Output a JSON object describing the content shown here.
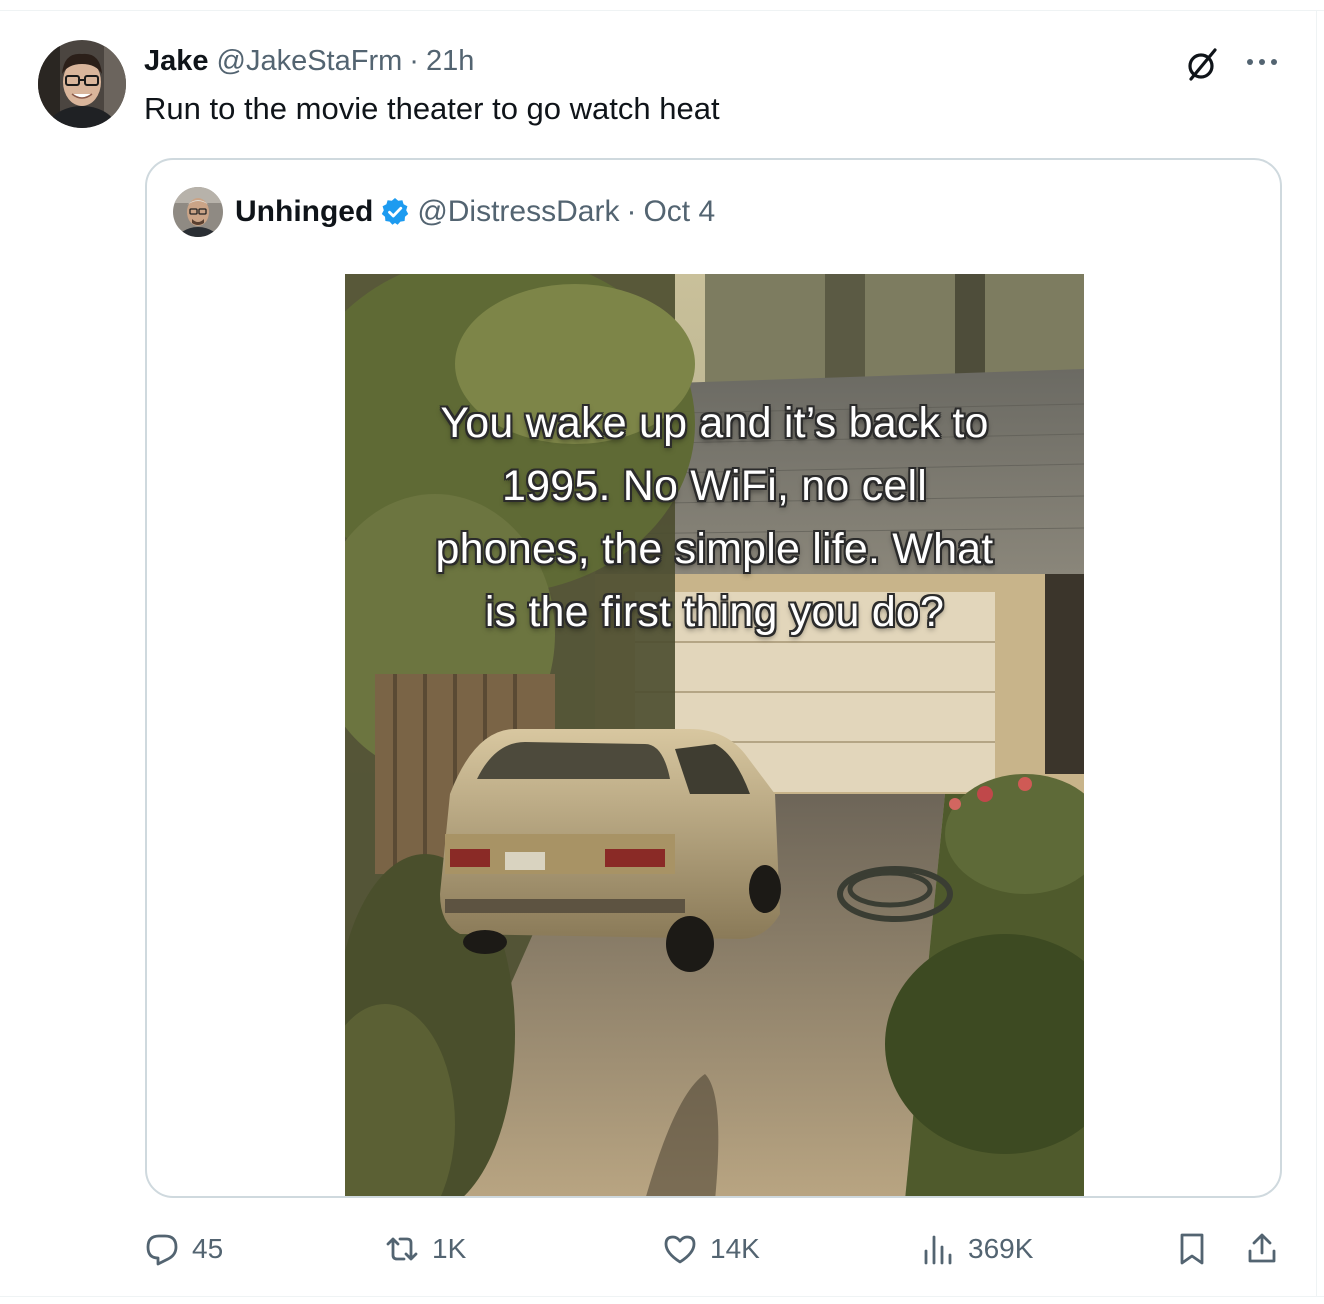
{
  "tweet": {
    "author_name": "Jake",
    "author_handle": "@JakeStaFrm",
    "separator": "·",
    "time": "21h",
    "text": "Run to the movie theater to go watch heat"
  },
  "quoted_tweet": {
    "author_name": "Unhinged",
    "verified": true,
    "author_handle": "@DistressDark",
    "separator": "·",
    "time": "Oct 4",
    "image_caption": "You wake up and it’s back to 1995. No WiFi, no cell phones, the simple life. What is the first thing you do?"
  },
  "actions": {
    "replies": "45",
    "reposts": "1K",
    "likes": "14K",
    "views": "369K"
  },
  "icons": [
    "grok-icon",
    "more-icon",
    "verified-badge-icon",
    "reply-icon",
    "retweet-icon",
    "like-icon",
    "views-icon",
    "bookmark-icon",
    "share-icon"
  ],
  "colors": {
    "text_primary": "#0f1419",
    "text_secondary": "#536471",
    "border": "#cfd9de",
    "verified_blue": "#1d9bf0"
  }
}
